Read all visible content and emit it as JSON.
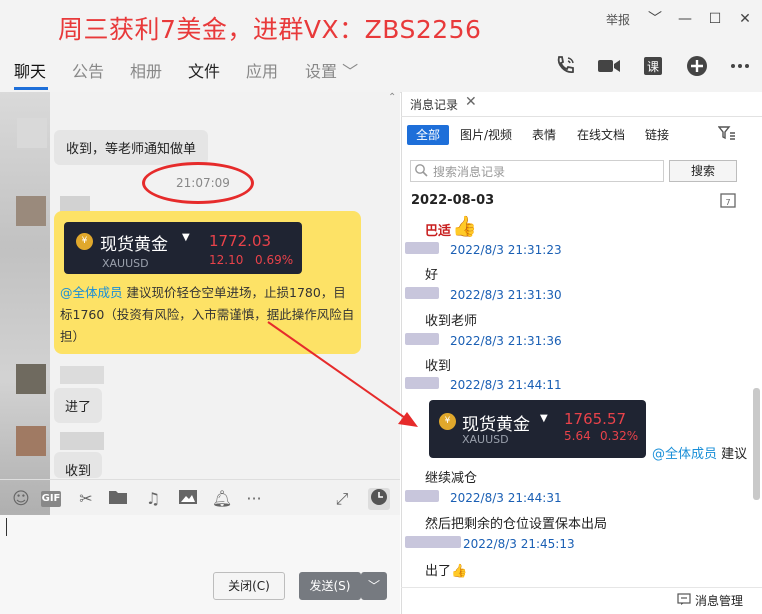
{
  "window": {
    "banner": "周三获利7美金，进群VX：ZBS2256",
    "report_label": "举报",
    "controls": [
      "﹀",
      "—",
      "☐",
      "✕"
    ]
  },
  "tabs": [
    {
      "label": "聊天"
    },
    {
      "label": "公告"
    },
    {
      "label": "相册"
    },
    {
      "label": "文件"
    },
    {
      "label": "应用"
    },
    {
      "label": "设置 ﹀"
    }
  ],
  "toolbar_icons": [
    "phone-icon",
    "video-icon",
    "class-icon",
    "add-icon",
    "more-icon"
  ],
  "chat": {
    "messages": [
      {
        "type": "text",
        "text": "收到，等老师通知做单"
      },
      {
        "type": "time",
        "text": "21:07:09"
      },
      {
        "type": "card",
        "card": {
          "name": "现货黄金",
          "code": "XAUUSD",
          "price": "1772.03",
          "change": "12.10",
          "change_pct": "0.69%",
          "icon": "¥"
        },
        "mention": "@全体成员",
        "text": " 建议现价轻仓空单进场，止损1780，目标1760（投资有风险，入市需谨慎，据此操作风险自担）"
      },
      {
        "type": "text",
        "text": "进了"
      },
      {
        "type": "text",
        "text": "收到"
      }
    ],
    "input_tools": [
      "emoji-icon",
      "gif-icon",
      "scissors-icon",
      "folder-icon",
      "music-icon",
      "image-icon",
      "bell-icon",
      "more-icon",
      "expand-icon",
      "clock-icon"
    ],
    "gif_label": "GIF",
    "close_button": "关闭(C)",
    "send_button": "发送(S)",
    "send_dropdown": "﹀"
  },
  "history": {
    "title": "消息记录",
    "close": "✕",
    "filters": [
      "全部",
      "图片/视频",
      "表情",
      "在线文档",
      "链接"
    ],
    "search_placeholder": "搜索消息记录",
    "search_button": "搜索",
    "date": "2022-08-03",
    "messages": [
      {
        "sender": "巴适",
        "text": "👍"
      },
      {
        "meta": "2022/8/3 21:31:23",
        "text": "好"
      },
      {
        "meta": "2022/8/3 21:31:30",
        "text": "收到老师"
      },
      {
        "meta": "2022/8/3 21:31:36",
        "text": "收到"
      },
      {
        "meta": "2022/8/3 21:44:11",
        "card": {
          "name": "现货黄金",
          "code": "XAUUSD",
          "price": "1765.57",
          "change": "5.64",
          "change_pct": "0.32%"
        },
        "mention": "@全体成员",
        "text": " 建议"
      },
      {
        "text": "继续减仓"
      },
      {
        "meta": "2022/8/3 21:44:31",
        "text": "然后把剩余的仓位设置保本出局"
      },
      {
        "meta": "2022/8/3 21:45:13",
        "text": "出了👍"
      }
    ],
    "footer": "消息管理"
  },
  "colors": {
    "accent": "#1e6fd9",
    "banner": "#e8393a",
    "highlight": "#fde266",
    "price_red": "#e8424a",
    "mention": "#1a8fd8"
  }
}
